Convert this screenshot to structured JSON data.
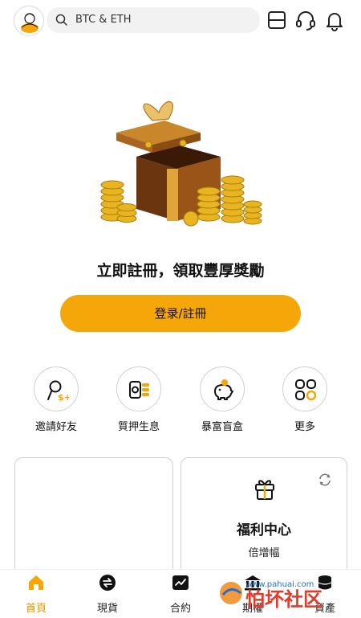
{
  "header": {
    "search_placeholder": "BTC & ETH",
    "icons": [
      "avatar",
      "search-icon",
      "scan-icon",
      "headset-icon",
      "bell-icon"
    ]
  },
  "hero": {
    "promo_text": "立即註冊，領取豐厚獎勵",
    "cta_label": "登录/註冊"
  },
  "shortcuts": [
    {
      "label": "邀請好友",
      "icon": "invite-user-icon"
    },
    {
      "label": "質押生息",
      "icon": "staking-icon"
    },
    {
      "label": "暴富盲盒",
      "icon": "piggy-bank-icon"
    },
    {
      "label": "更多",
      "icon": "more-grid-icon"
    }
  ],
  "cards": {
    "welfare_title": "福利中心",
    "welfare_subtitle": "倍增幅"
  },
  "bottom_nav": [
    {
      "label": "首頁",
      "icon": "home-icon",
      "active": true
    },
    {
      "label": "現貨",
      "icon": "spot-exchange-icon",
      "active": false
    },
    {
      "label": "合約",
      "icon": "contract-chart-icon",
      "active": false
    },
    {
      "label": "期權",
      "icon": "options-bank-icon",
      "active": false
    },
    {
      "label": "資產",
      "icon": "assets-coins-icon",
      "active": false
    }
  ],
  "watermark": {
    "brand": "怕坏社区",
    "url": "www.pahuai.com"
  },
  "colors": {
    "accent": "#f5a70a",
    "active_nav": "#e29700",
    "border": "#cfcfcf"
  }
}
